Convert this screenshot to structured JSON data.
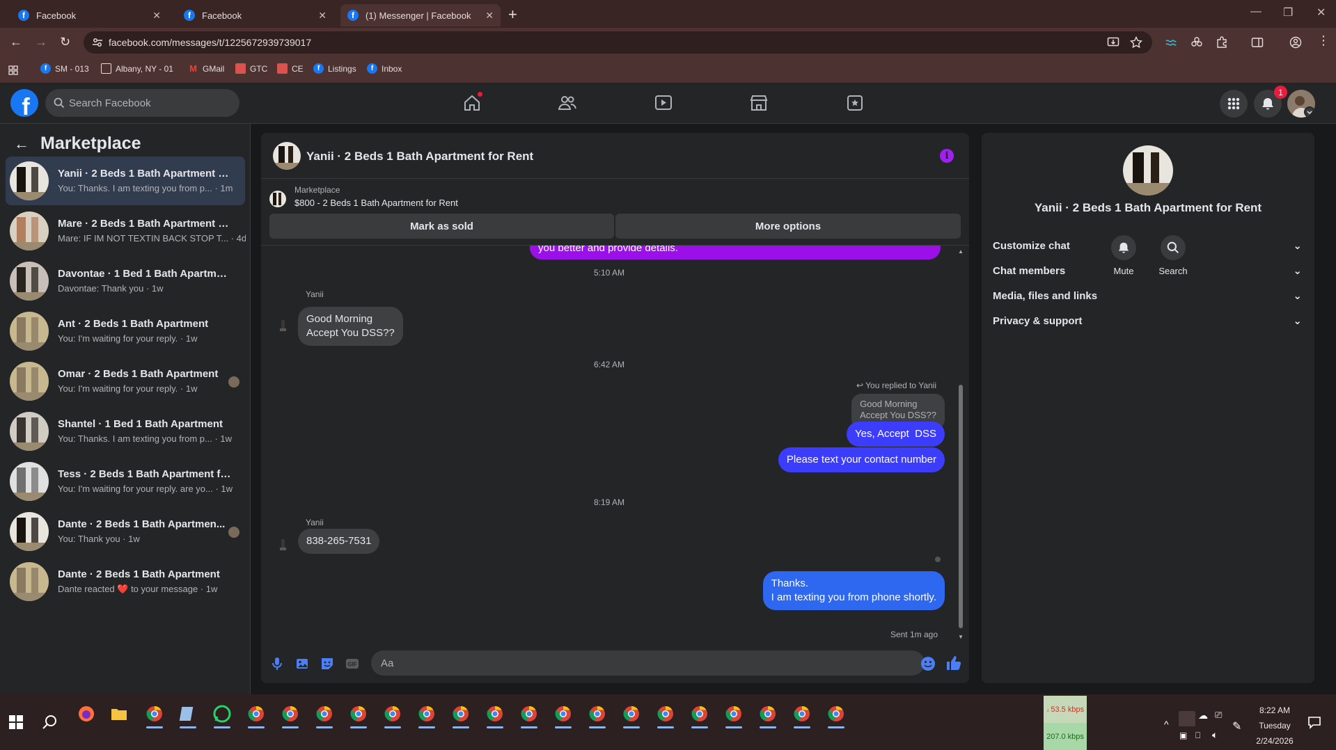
{
  "browser": {
    "tabs": [
      {
        "title": "Facebook",
        "active": false
      },
      {
        "title": "Facebook",
        "active": false
      },
      {
        "title": "(1) Messenger | Facebook",
        "active": true
      }
    ],
    "url": "facebook.com/messages/t/1225672939739017",
    "bookmarks": [
      "SM - 013",
      "Albany, NY - 01",
      "GMail",
      "GTC",
      "CE",
      "Listings",
      "Inbox"
    ]
  },
  "fbnav": {
    "search_placeholder": "Search Facebook",
    "notification_count": "1"
  },
  "sidebar": {
    "title": "Marketplace",
    "conversations": [
      {
        "title": "Yanii · 2 Beds 1 Bath Apartment for...",
        "snippet": "You: Thanks. I am texting you from p... · 1m",
        "selected": true
      },
      {
        "title": "Mare · 2 Beds 1 Bath Apartment fo...",
        "snippet": "Mare: IF IM NOT TEXTIN BACK STOP T... · 4d"
      },
      {
        "title": "Davontae · 1 Bed 1 Bath Apartment",
        "snippet": "Davontae: Thank you · 1w"
      },
      {
        "title": "Ant · 2 Beds 1 Bath Apartment",
        "snippet": "You: I'm waiting for your reply. · 1w"
      },
      {
        "title": "Omar · 2 Beds 1 Bath Apartment",
        "snippet": "You: I'm waiting for your reply. · 1w"
      },
      {
        "title": "Shantel · 1 Bed 1 Bath Apartment",
        "snippet": "You: Thanks. I am texting you from p... · 1w"
      },
      {
        "title": "Tess · 2 Beds 1 Bath Apartment for ...",
        "snippet": "You: I'm waiting for your reply. are yo... · 1w"
      },
      {
        "title": "Dante · 2 Beds 1 Bath Apartmen...",
        "snippet": "You: Thank you · 1w"
      },
      {
        "title": "Dante · 2 Beds 1 Bath Apartment",
        "snippet": "Dante reacted ❤️ to your message · 1w"
      }
    ]
  },
  "chat": {
    "title": "Yanii · 2 Beds 1 Bath Apartment for Rent",
    "marketplace_label": "Marketplace",
    "listing": "$800 - 2 Beds 1 Bath Apartment for Rent",
    "mark_sold": "Mark as sold",
    "more_options": "More options",
    "cutoff_message": "you better and provide details.",
    "time1": "5:10 AM",
    "sender1": "Yanii",
    "msg1_line1": "Good Morning",
    "msg1_line2": "Accept You DSS??",
    "time2": "6:42 AM",
    "replied_to": "You replied to Yanii",
    "quote_line1": "Good Morning",
    "quote_line2": "Accept You DSS??",
    "reply": "Yes, Accept  DSS",
    "msg_contact": "Please text your contact number",
    "time3": "8:19 AM",
    "sender2": "Yanii",
    "msg_phone": "838-265-7531",
    "thanks_line1": "Thanks.",
    "thanks_line2": "I am texting you from phone shortly.",
    "sent_status": "Sent 1m ago",
    "input_placeholder": "Aa"
  },
  "details": {
    "title": "Yanii · 2 Beds 1 Bath Apartment for Rent",
    "mute": "Mute",
    "search": "Search",
    "sections": [
      "Customize chat",
      "Chat members",
      "Media, files and links",
      "Privacy & support"
    ]
  },
  "taskbar": {
    "upload": "53.5 kbps",
    "download": "207.0 kbps",
    "time": "8:22 AM",
    "day": "Tuesday",
    "date": "2/24/2026"
  },
  "colors": {
    "accent": "#1877f2",
    "outgoing_bubble": "#3c3dfb",
    "cutoff_bubble": "#9b0fe8"
  }
}
